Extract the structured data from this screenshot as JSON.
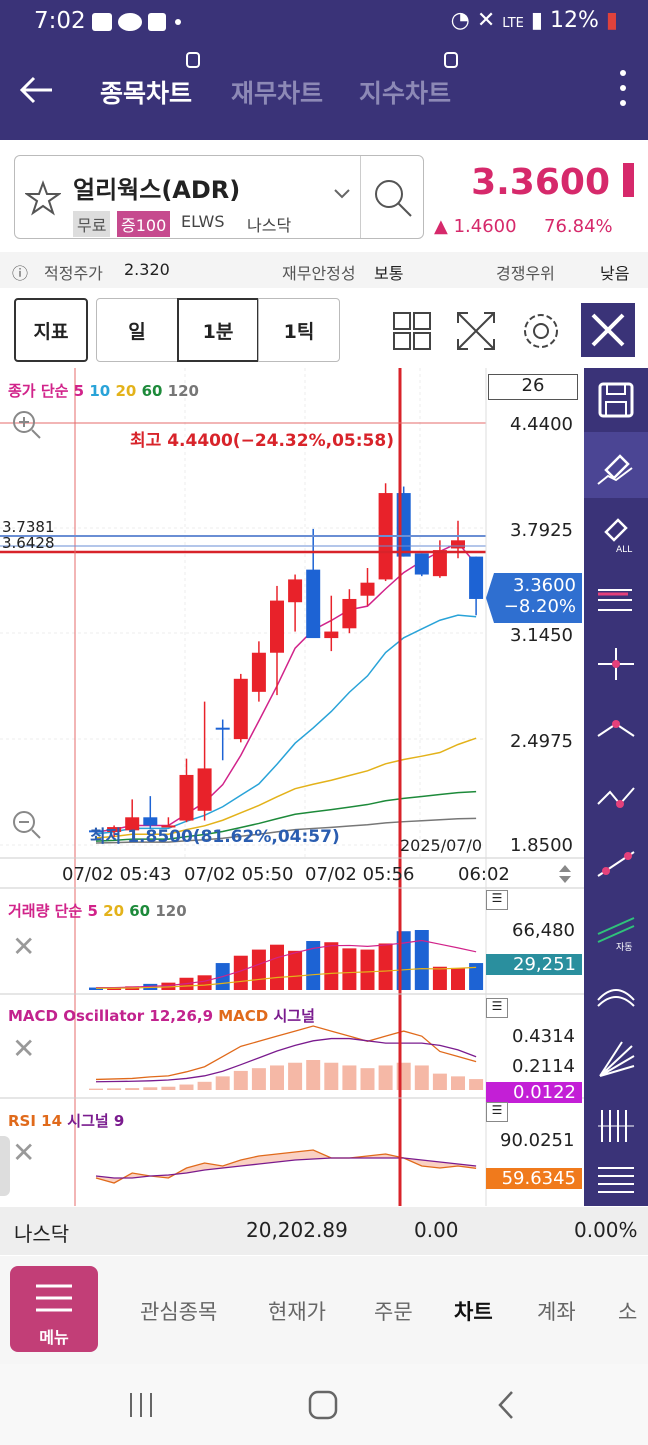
{
  "status": {
    "time": "7:02",
    "battery": "12%"
  },
  "header": {
    "tabs": [
      {
        "label": "종목차트",
        "active": true
      },
      {
        "label": "재무차트",
        "active": false
      },
      {
        "label": "지수차트",
        "active": false
      }
    ]
  },
  "stock": {
    "name": "얼리웍스(ADR)",
    "tags": [
      "무료",
      "증100",
      "ELWS",
      "나스닥"
    ],
    "price": "3.3600",
    "change": "▲ 1.4600",
    "change_pct": "76.84%"
  },
  "info": {
    "fair_price_label": "적정주가",
    "fair_price": "2.320",
    "stability_label": "재무안정성",
    "stability": "보통",
    "competition_label": "경쟁우위",
    "competition": "낮음"
  },
  "toolbar": {
    "indicator": "지표",
    "day": "일",
    "minute": "1분",
    "tick": "1틱"
  },
  "price_chart": {
    "legend_prefix": "종가 단순",
    "ma_periods": [
      "5",
      "10",
      "20",
      "60",
      "120"
    ],
    "ma_colors": [
      "#d1238a",
      "#29a3d8",
      "#e3b21a",
      "#1d8a3a",
      "#777777"
    ],
    "count": "26",
    "high_note": "최고 4.4400(−24.32%,05:58)",
    "low_note": "최저 1.8500(81.62%,04:57)",
    "date_note": "2025/07/0",
    "y_ticks": [
      "4.4400",
      "3.7925",
      "3.1450",
      "2.4975",
      "1.8500"
    ],
    "h_level_1": "3.7381",
    "h_level_2": "3.6428",
    "current_price": "3.3600",
    "current_pct": "−8.20%",
    "x_ticks": [
      "07/02 05:43",
      "07/02 05:50",
      "07/02 05:56",
      "06:02"
    ],
    "ylim": [
      1.85,
      4.44
    ]
  },
  "volume_chart": {
    "legend_prefix": "거래량 단순",
    "ma_periods": [
      "5",
      "20",
      "60",
      "120"
    ],
    "top_value": "66,480",
    "current_value": "29,251"
  },
  "macd_chart": {
    "title": "MACD Oscillator 12,26,9",
    "macd_label": "MACD",
    "signal_label": "시그널",
    "values": [
      "0.4314",
      "0.2114"
    ],
    "current_value": "0.0122"
  },
  "rsi_chart": {
    "title": "RSI 14",
    "signal_label": "시그널 9",
    "top_value": "90.0251",
    "current_value": "59.6345"
  },
  "index_bar": {
    "name": "나스닥",
    "value": "20,202.89",
    "change": "0.00",
    "change_pct": "0.00%"
  },
  "nav": {
    "menu_label": "메뉴",
    "items": [
      {
        "label": "관심종목",
        "active": false
      },
      {
        "label": "현재가",
        "active": false
      },
      {
        "label": "주문",
        "active": false
      },
      {
        "label": "차트",
        "active": true
      },
      {
        "label": "계좌",
        "active": false
      },
      {
        "label": "소",
        "active": false
      }
    ]
  },
  "chart_data": {
    "type": "candlestick",
    "title": "",
    "x_ticks": [
      "07/02 05:43",
      "07/02 05:50",
      "07/02 05:56",
      "06:02"
    ],
    "ylim": [
      1.85,
      4.44
    ],
    "y_ticks": [
      4.44,
      3.7925,
      3.145,
      2.4975,
      1.85
    ],
    "candles": [
      {
        "o": 1.94,
        "h": 1.94,
        "l": 1.92,
        "c": 1.93
      },
      {
        "o": 1.93,
        "h": 1.97,
        "l": 1.9,
        "c": 1.96
      },
      {
        "o": 1.94,
        "h": 2.13,
        "l": 1.93,
        "c": 2.02
      },
      {
        "o": 2.02,
        "h": 2.15,
        "l": 1.95,
        "c": 1.97
      },
      {
        "o": 1.97,
        "h": 2.02,
        "l": 1.97,
        "c": 1.97
      },
      {
        "o": 2.0,
        "h": 2.38,
        "l": 1.99,
        "c": 2.28
      },
      {
        "o": 2.06,
        "h": 2.73,
        "l": 2.0,
        "c": 2.32
      },
      {
        "o": 2.57,
        "h": 2.62,
        "l": 2.37,
        "c": 2.56
      },
      {
        "o": 2.5,
        "h": 2.9,
        "l": 2.48,
        "c": 2.87
      },
      {
        "o": 2.79,
        "h": 3.1,
        "l": 2.73,
        "c": 3.03
      },
      {
        "o": 3.03,
        "h": 3.44,
        "l": 2.77,
        "c": 3.35
      },
      {
        "o": 3.34,
        "h": 3.51,
        "l": 3.16,
        "c": 3.48
      },
      {
        "o": 3.54,
        "h": 3.79,
        "l": 3.14,
        "c": 3.12
      },
      {
        "o": 3.12,
        "h": 3.38,
        "l": 3.04,
        "c": 3.16
      },
      {
        "o": 3.18,
        "h": 3.42,
        "l": 3.15,
        "c": 3.36
      },
      {
        "o": 3.38,
        "h": 3.55,
        "l": 3.32,
        "c": 3.46
      },
      {
        "o": 3.48,
        "h": 4.07,
        "l": 3.47,
        "c": 4.01
      },
      {
        "o": 4.01,
        "h": 4.05,
        "l": 3.62,
        "c": 3.62
      },
      {
        "o": 3.64,
        "h": 3.64,
        "l": 3.5,
        "c": 3.51
      },
      {
        "o": 3.5,
        "h": 3.72,
        "l": 3.49,
        "c": 3.66
      },
      {
        "o": 3.67,
        "h": 3.84,
        "l": 3.61,
        "c": 3.72
      },
      {
        "o": 3.62,
        "h": 3.62,
        "l": 3.26,
        "c": 3.36
      }
    ],
    "volume": [
      2,
      2,
      3,
      5,
      6,
      10,
      12,
      22,
      28,
      33,
      37,
      32,
      40,
      39,
      34,
      33,
      38,
      48,
      49,
      19,
      18,
      22
    ],
    "macd_hist": [
      0.005,
      0.006,
      0.007,
      0.01,
      0.012,
      0.02,
      0.03,
      0.05,
      0.07,
      0.08,
      0.09,
      0.1,
      0.11,
      0.1,
      0.09,
      0.08,
      0.09,
      0.1,
      0.09,
      0.06,
      0.05,
      0.04
    ],
    "rsi": [
      50,
      45,
      55,
      52,
      50,
      60,
      65,
      62,
      68,
      72,
      74,
      76,
      78,
      70,
      70,
      72,
      74,
      70,
      62,
      60,
      62,
      59.6
    ],
    "rsi_signal": [
      52,
      50,
      50,
      52,
      53,
      55,
      58,
      60,
      62,
      64,
      66,
      68,
      69,
      70,
      70,
      70,
      70,
      70,
      68,
      66,
      64,
      62
    ],
    "xlabel": "",
    "ylabel": ""
  }
}
